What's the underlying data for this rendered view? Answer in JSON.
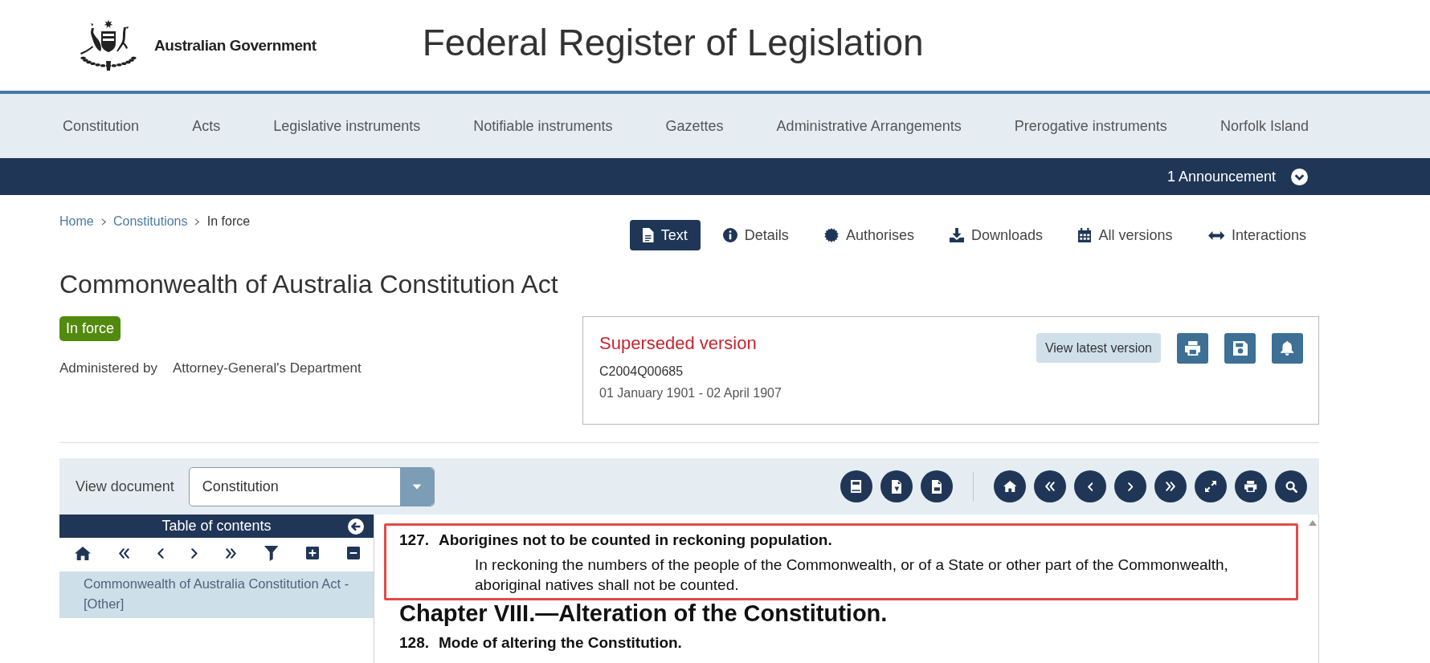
{
  "header": {
    "agency": "Australian Government",
    "site_title": "Federal Register of Legislation"
  },
  "nav": [
    "Constitution",
    "Acts",
    "Legislative instruments",
    "Notifiable instruments",
    "Gazettes",
    "Administrative Arrangements",
    "Prerogative instruments",
    "Norfolk Island"
  ],
  "announcement": {
    "label": "1 Announcement",
    "expanded": false
  },
  "breadcrumbs": [
    {
      "label": "Home",
      "kind": "link"
    },
    {
      "label": "Constitutions",
      "kind": "link"
    },
    {
      "label": "In force",
      "kind": "current"
    }
  ],
  "tabs": [
    {
      "label": "Text",
      "selected": true
    },
    {
      "label": "Details",
      "selected": false
    },
    {
      "label": "Authorises",
      "selected": false
    },
    {
      "label": "Downloads",
      "selected": false
    },
    {
      "label": "All versions",
      "selected": false
    },
    {
      "label": "Interactions",
      "selected": false
    }
  ],
  "document": {
    "title": "Commonwealth of Australia Constitution Act",
    "status": "In force",
    "administered_label": "Administered by",
    "administered_by": "Attorney-General's Department"
  },
  "version": {
    "heading": "Superseded version",
    "register_id": "C2004Q00685",
    "period": "01 January 1901 - 02 April 1907",
    "view_latest_button": "View latest version"
  },
  "viewer": {
    "view_document_label": "View document",
    "document_select": {
      "value": "Constitution"
    },
    "toc": {
      "title": "Table of contents",
      "items": [
        {
          "label": "Commonwealth of Australia Constitution Act - [Other]",
          "selected": true
        }
      ]
    },
    "content": [
      {
        "kind": "section",
        "number": "127.",
        "heading": "Aborigines not to be counted in reckoning population.",
        "body": "In reckoning the numbers of the people of the Commonwealth, or of a State or other part of the Commonwealth, aboriginal natives shall not be counted.",
        "highlighted": true
      },
      {
        "kind": "chapter",
        "heading": "Chapter VIII.—Alteration of the Constitution."
      },
      {
        "kind": "section",
        "number": "128.",
        "heading": "Mode of altering the Constitution.",
        "highlighted": false
      }
    ]
  }
}
